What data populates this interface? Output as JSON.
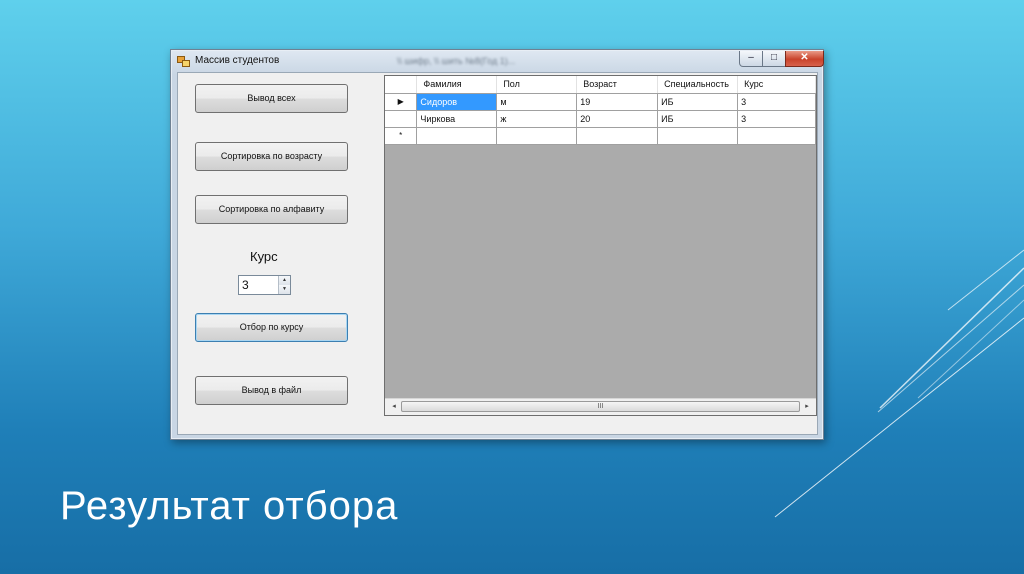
{
  "window": {
    "title": "Массив студентов",
    "title_blurred": "\\\\ шифр, \\\\ шить №8(Год 1)...",
    "controls": {
      "minimize": "–",
      "maximize": "□",
      "close": "✕"
    }
  },
  "buttons": {
    "show_all": "Вывод всех",
    "sort_age": "Сортировка по возрасту",
    "sort_alpha": "Сортировка по алфавиту",
    "filter_course": "Отбор по курсу",
    "output_file": "Вывод в файл"
  },
  "course": {
    "label": "Курс",
    "value": "3"
  },
  "grid": {
    "columns": [
      "Фамилия",
      "Пол",
      "Возраст",
      "Специальность",
      "Курс"
    ],
    "rows": [
      {
        "indicator": "▶",
        "cells": [
          "Сидоров",
          "м",
          "19",
          "ИБ",
          "3"
        ]
      },
      {
        "indicator": "",
        "cells": [
          "Чиркова",
          "ж",
          "20",
          "ИБ",
          "3"
        ]
      }
    ],
    "new_row_indicator": "*",
    "scroll": {
      "left": "◂",
      "right": "▸",
      "thumb": "III"
    }
  },
  "slide": {
    "title": "Результат отбора"
  }
}
